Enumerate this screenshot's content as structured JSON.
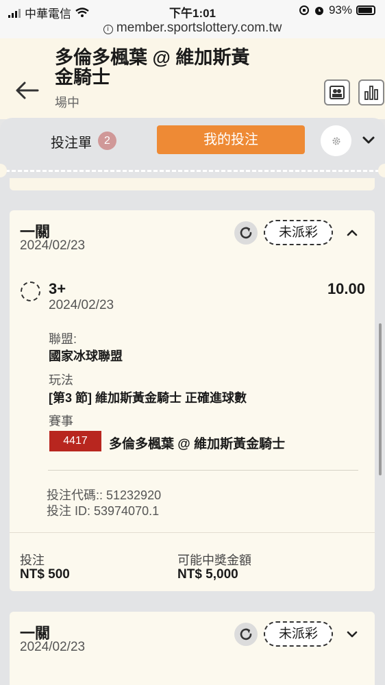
{
  "status_bar": {
    "carrier": "中華電信",
    "time": "下午1:01",
    "battery": "93%"
  },
  "url_bar": {
    "url": "member.sportslottery.com.tw"
  },
  "header": {
    "title": "多倫多楓葉 @ 維加斯黃金騎士",
    "status": "場中"
  },
  "betslip": {
    "slip_label": "投注單",
    "slip_count": "2",
    "my_bets_label": "我的投注"
  },
  "bets": [
    {
      "type": "一關",
      "date": "2024/02/23",
      "status": "未派彩",
      "expanded": true,
      "selection": {
        "name": "3+",
        "odds": "10.00",
        "date": "2024/02/23",
        "league_label": "聯盟:",
        "league": "國家冰球聯盟",
        "market_label": "玩法",
        "market": "[第3 節] 維加斯黃金騎士 正確進球數",
        "event_label": "賽事",
        "event_code": "4417",
        "event_name": "多倫多楓葉 @ 維加斯黃金騎士"
      },
      "bet_code": "投注代碼:: 51232920",
      "bet_id": "投注 ID: 53974070.1",
      "stake_label": "投注",
      "stake": "NT$ 500",
      "payout_label": "可能中獎金額",
      "payout": "NT$ 5,000"
    },
    {
      "type": "一關",
      "date": "2024/02/23",
      "status": "未派彩",
      "expanded": false
    }
  ],
  "colors": {
    "accent_orange": "#ee8a35",
    "event_tag_red": "#b8261f",
    "badge": "#d09898",
    "card_bg": "#fcf9ee"
  },
  "icons": [
    "signal-icon",
    "wifi-icon",
    "lock-rotation-icon",
    "alarm-icon",
    "battery-icon",
    "info-icon",
    "back-arrow-icon",
    "lineup-icon",
    "stats-icon",
    "gear-icon",
    "chevron-down-icon",
    "refresh-icon",
    "chevron-up-icon"
  ]
}
